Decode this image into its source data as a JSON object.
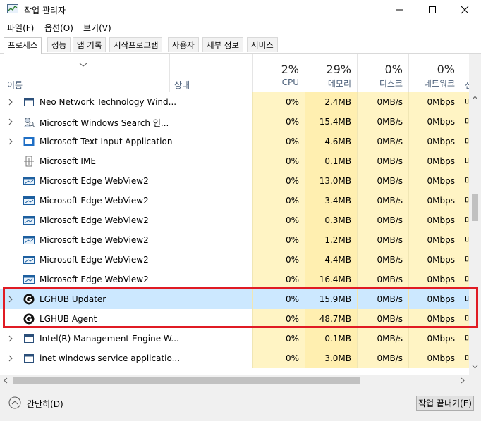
{
  "window": {
    "title": "작업 관리자"
  },
  "menu": [
    "파일(F)",
    "옵션(O)",
    "보기(V)"
  ],
  "tabs": [
    "프로세스",
    "성능",
    "앱 기록",
    "시작프로그램",
    "사용자",
    "세부 정보",
    "서비스"
  ],
  "columns": {
    "name": "이름",
    "status": "상태",
    "cpu": {
      "pct": "2%",
      "label": "CPU"
    },
    "memory": {
      "pct": "29%",
      "label": "메모리"
    },
    "disk": {
      "pct": "0%",
      "label": "디스크"
    },
    "network": {
      "pct": "0%",
      "label": "네트워크"
    },
    "power": {
      "label": "전력"
    }
  },
  "rows": [
    {
      "name": "Neo Network Technology Wind...",
      "cpu": "0%",
      "mem": "2.4MB",
      "disk": "0MB/s",
      "net": "0Mbps",
      "power": "매",
      "icon": "window-icon",
      "expand": true
    },
    {
      "name": "Microsoft Windows Search 인...",
      "cpu": "0%",
      "mem": "15.4MB",
      "disk": "0MB/s",
      "net": "0Mbps",
      "power": "매",
      "icon": "search-user-icon",
      "expand": true
    },
    {
      "name": "Microsoft Text Input Application",
      "cpu": "0%",
      "mem": "4.6MB",
      "disk": "0MB/s",
      "net": "0Mbps",
      "power": "매",
      "icon": "keyboard-icon",
      "expand": true
    },
    {
      "name": "Microsoft IME",
      "cpu": "0%",
      "mem": "0.1MB",
      "disk": "0MB/s",
      "net": "0Mbps",
      "power": "매",
      "icon": "ime-icon",
      "expand": false
    },
    {
      "name": "Microsoft Edge WebView2",
      "cpu": "0%",
      "mem": "13.0MB",
      "disk": "0MB/s",
      "net": "0Mbps",
      "power": "매",
      "icon": "webview-icon",
      "expand": false
    },
    {
      "name": "Microsoft Edge WebView2",
      "cpu": "0%",
      "mem": "3.4MB",
      "disk": "0MB/s",
      "net": "0Mbps",
      "power": "매",
      "icon": "webview-icon",
      "expand": false
    },
    {
      "name": "Microsoft Edge WebView2",
      "cpu": "0%",
      "mem": "0.3MB",
      "disk": "0MB/s",
      "net": "0Mbps",
      "power": "매",
      "icon": "webview-icon",
      "expand": false
    },
    {
      "name": "Microsoft Edge WebView2",
      "cpu": "0%",
      "mem": "1.2MB",
      "disk": "0MB/s",
      "net": "0Mbps",
      "power": "매",
      "icon": "webview-icon",
      "expand": false
    },
    {
      "name": "Microsoft Edge WebView2",
      "cpu": "0%",
      "mem": "4.4MB",
      "disk": "0MB/s",
      "net": "0Mbps",
      "power": "매",
      "icon": "webview-icon",
      "expand": false
    },
    {
      "name": "Microsoft Edge WebView2",
      "cpu": "0%",
      "mem": "16.4MB",
      "disk": "0MB/s",
      "net": "0Mbps",
      "power": "매",
      "icon": "webview-icon",
      "expand": false
    },
    {
      "name": "LGHUB Updater",
      "cpu": "0%",
      "mem": "15.9MB",
      "disk": "0MB/s",
      "net": "0Mbps",
      "power": "매",
      "icon": "logitech-g-icon",
      "expand": true,
      "selected": true
    },
    {
      "name": "LGHUB Agent",
      "cpu": "0%",
      "mem": "48.7MB",
      "disk": "0MB/s",
      "net": "0Mbps",
      "power": "매",
      "icon": "logitech-g-icon",
      "expand": false
    },
    {
      "name": "Intel(R) Management Engine W...",
      "cpu": "0%",
      "mem": "0.1MB",
      "disk": "0MB/s",
      "net": "0Mbps",
      "power": "매",
      "icon": "window-icon",
      "expand": true
    },
    {
      "name": "inet windows service applicatio...",
      "cpu": "0%",
      "mem": "3.0MB",
      "disk": "0MB/s",
      "net": "0Mbps",
      "power": "매",
      "icon": "window-icon",
      "expand": true
    }
  ],
  "footer": {
    "fewer_details": "간단히(D)",
    "end_task": "작업 끝내기(E)"
  },
  "colors": {
    "highlight": "#e01b24",
    "metric_bg": "#fff4c4",
    "selected_bg": "#cce8ff"
  }
}
